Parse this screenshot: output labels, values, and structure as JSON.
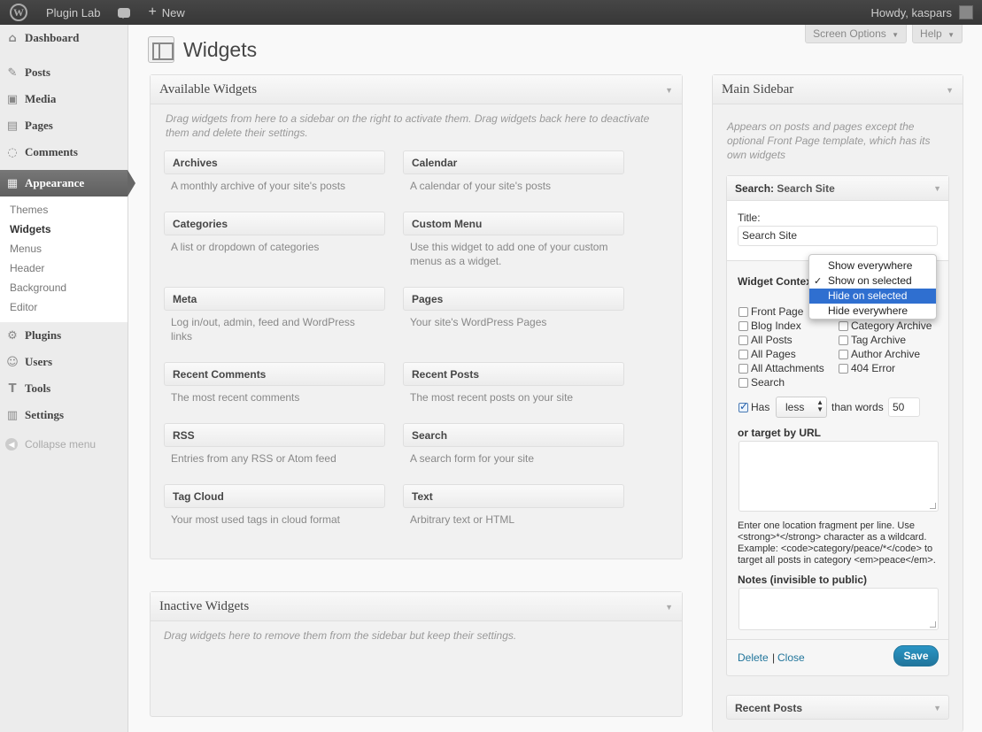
{
  "admin_bar": {
    "wp_logo": "W",
    "site_name": "Plugin Lab",
    "new_label": "New",
    "new_prefix": "+",
    "greeting": "Howdy, kaspars"
  },
  "menu": {
    "dashboard": "Dashboard",
    "posts": "Posts",
    "media": "Media",
    "pages": "Pages",
    "comments": "Comments",
    "appearance": "Appearance",
    "submenu": {
      "themes": "Themes",
      "widgets": "Widgets",
      "menus": "Menus",
      "header": "Header",
      "background": "Background",
      "editor": "Editor"
    },
    "plugins": "Plugins",
    "users": "Users",
    "tools": "Tools",
    "settings": "Settings",
    "collapse": "Collapse menu"
  },
  "header": {
    "screen_options": "Screen Options",
    "help": "Help",
    "title": "Widgets"
  },
  "available": {
    "title": "Available Widgets",
    "description": "Drag widgets from here to a sidebar on the right to activate them. Drag widgets back here to deactivate them and delete their settings.",
    "widgets": [
      {
        "name": "Archives",
        "desc": "A monthly archive of your site's posts"
      },
      {
        "name": "Calendar",
        "desc": "A calendar of your site's posts"
      },
      {
        "name": "Categories",
        "desc": "A list or dropdown of categories"
      },
      {
        "name": "Custom Menu",
        "desc": "Use this widget to add one of your custom menus as a widget."
      },
      {
        "name": "Meta",
        "desc": "Log in/out, admin, feed and WordPress links"
      },
      {
        "name": "Pages",
        "desc": "Your site's WordPress Pages"
      },
      {
        "name": "Recent Comments",
        "desc": "The most recent comments"
      },
      {
        "name": "Recent Posts",
        "desc": "The most recent posts on your site"
      },
      {
        "name": "RSS",
        "desc": "Entries from any RSS or Atom feed"
      },
      {
        "name": "Search",
        "desc": "A search form for your site"
      },
      {
        "name": "Tag Cloud",
        "desc": "Your most used tags in cloud format"
      },
      {
        "name": "Text",
        "desc": "Arbitrary text or HTML"
      }
    ]
  },
  "inactive": {
    "title": "Inactive Widgets",
    "description": "Drag widgets here to remove them from the sidebar but keep their settings."
  },
  "main_sidebar": {
    "title": "Main Sidebar",
    "description": "Appears on posts and pages except the optional Front Page template, which has its own widgets",
    "search_widget": {
      "head_type": "Search:",
      "head_title": "Search Site",
      "title_label": "Title:",
      "title_value": "Search Site",
      "context_label": "Widget Contex",
      "context_options": [
        "Show everywhere",
        "Show on selected",
        "Hide on selected",
        "Hide everywhere"
      ],
      "context_checked": "Show on selected",
      "context_highlighted": "Hide on selected",
      "checkboxes_left": [
        "Front Page",
        "Blog Index",
        "All Posts",
        "All Pages",
        "All Attachments",
        "Search"
      ],
      "checkboxes_right": [
        "Category Archive",
        "Tag Archive",
        "Author Archive",
        "404 Error"
      ],
      "has_label": "Has",
      "has_checked": true,
      "comparator": "less",
      "than_words": "than words",
      "word_count": "50",
      "url_label": "or target by URL",
      "url_help_1": "Enter one location fragment per line. Use",
      "url_help_2": "<strong>*</strong> character as a wildcard.",
      "url_help_3": "Example: <code>category/peace/*</code> to",
      "url_help_4": "target all posts in category <em>peace</em>.",
      "notes_label": "Notes (invisible to public)",
      "delete": "Delete",
      "separator": "|",
      "close": "Close",
      "save": "Save"
    },
    "next_widget": "Recent Posts"
  },
  "colors": {
    "accent": "#21759b",
    "highlight": "#2f6fd0",
    "admin_bar": "#464646"
  }
}
